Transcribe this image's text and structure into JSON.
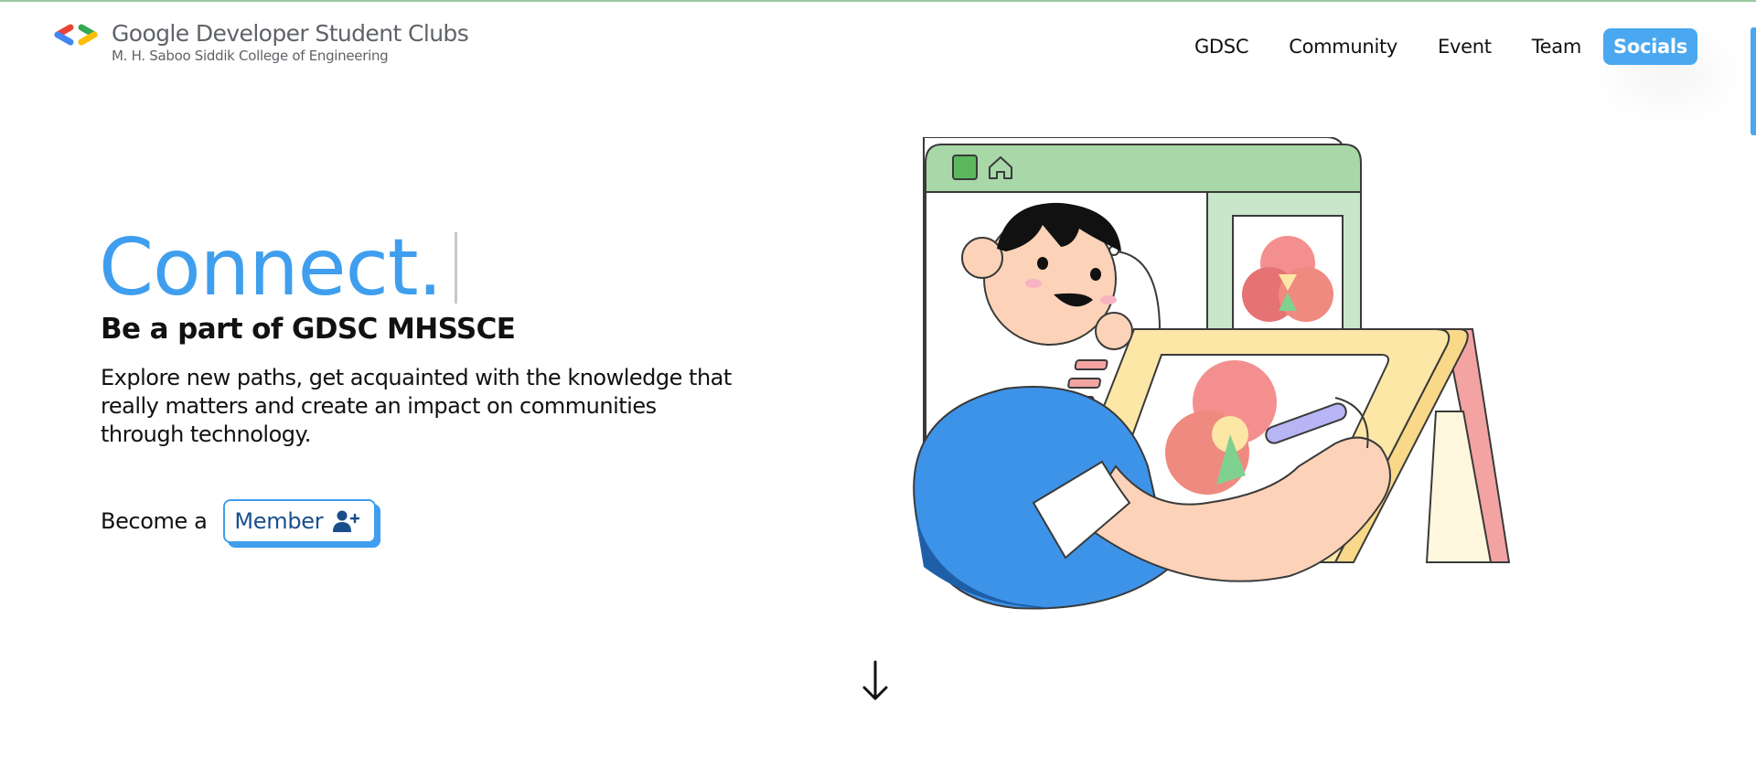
{
  "brand": {
    "title": "Google Developer Student Clubs",
    "subtitle": "M. H. Saboo Siddik College of Engineering",
    "logo_icon": "gdsc-logo-icon",
    "logo_colors": [
      "#ea4335",
      "#4285f4",
      "#34a853",
      "#fbbc04"
    ]
  },
  "nav": {
    "items": [
      {
        "label": "GDSC"
      },
      {
        "label": "Community"
      },
      {
        "label": "Event"
      },
      {
        "label": "Team"
      }
    ],
    "socials_label": "Socials"
  },
  "hero": {
    "title": "Connect.",
    "subtitle": "Be a part of GDSC MHSSCE",
    "description": "Explore new paths, get acquainted with the knowledge that really matters and create an impact on communities through technology.",
    "cta_prefix": "Become a",
    "cta_button": "Member",
    "cta_icon": "user-plus-icon",
    "illustration": "person-drawing-on-tablet-illustration"
  },
  "scroll_indicator_icon": "arrow-down-icon",
  "colors": {
    "accent": "#4aa8f0",
    "title_blue": "#3f9eee",
    "button_text": "#1a4f8c",
    "window_green": "#a8d8a8",
    "tablet_yellow": "#fce7a6",
    "shirt_blue": "#3d93e8"
  }
}
